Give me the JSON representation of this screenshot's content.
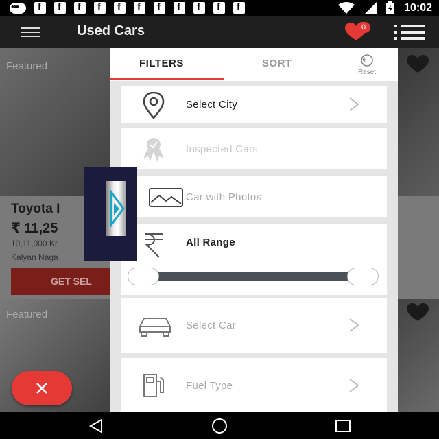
{
  "status_bar": {
    "time": "10:02",
    "left_icons": [
      "messenger-icon",
      "facebook-icon",
      "facebook-icon",
      "facebook-icon",
      "facebook-icon",
      "facebook-icon",
      "facebook-icon",
      "facebook-icon",
      "facebook-icon",
      "facebook-icon",
      "facebook-icon",
      "facebook-icon"
    ],
    "right_icons": [
      "wifi-icon",
      "signal-icon",
      "battery-icon"
    ]
  },
  "app_bar": {
    "title": "Used Cars",
    "favorites_count": "0"
  },
  "listings": [
    {
      "badge": "Featured",
      "title": "Toyota I",
      "price": "₹ 11,25",
      "kms": "10,11,000 Kr",
      "location": "Kalyan Naga",
      "cta": "GET SEL"
    },
    {
      "badge": "Featured"
    }
  ],
  "filter_panel": {
    "tabs": {
      "filters": "FILTERS",
      "sort": "SORT"
    },
    "reset_label": "Reset",
    "rows": {
      "city": "Select City",
      "inspected": "Inspected Cars",
      "photos": "Car with Photos",
      "range": "All Range",
      "car": "Select Car",
      "fuel": "Fuel Type"
    }
  },
  "colors": {
    "accent": "#e53935",
    "app_bar": "#1f1f1f",
    "panel_bg": "#e5e5e5",
    "slider_track": "#4a5257"
  }
}
